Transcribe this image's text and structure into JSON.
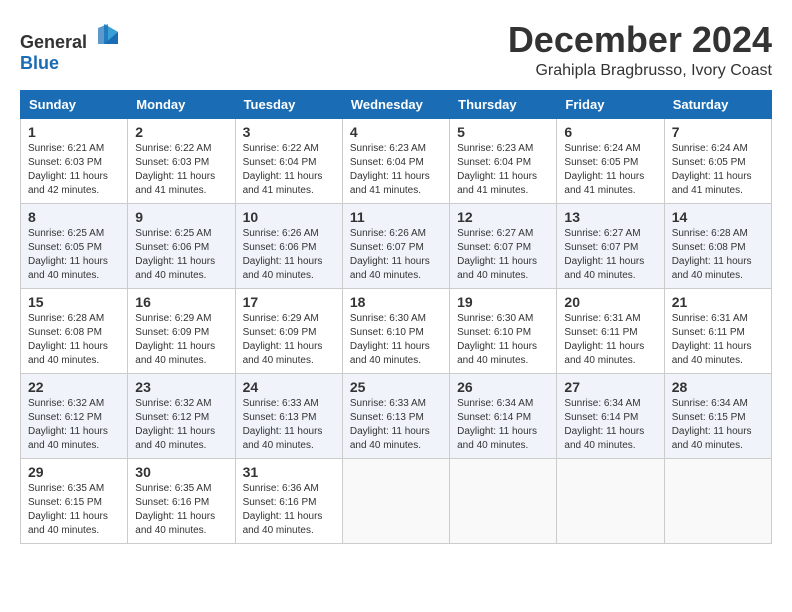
{
  "header": {
    "logo_general": "General",
    "logo_blue": "Blue",
    "month_title": "December 2024",
    "location": "Grahipla Bragbrusso, Ivory Coast"
  },
  "weekdays": [
    "Sunday",
    "Monday",
    "Tuesday",
    "Wednesday",
    "Thursday",
    "Friday",
    "Saturday"
  ],
  "weeks": [
    [
      {
        "day": "1",
        "sunrise": "6:21 AM",
        "sunset": "6:03 PM",
        "daylight": "11 hours and 42 minutes."
      },
      {
        "day": "2",
        "sunrise": "6:22 AM",
        "sunset": "6:03 PM",
        "daylight": "11 hours and 41 minutes."
      },
      {
        "day": "3",
        "sunrise": "6:22 AM",
        "sunset": "6:04 PM",
        "daylight": "11 hours and 41 minutes."
      },
      {
        "day": "4",
        "sunrise": "6:23 AM",
        "sunset": "6:04 PM",
        "daylight": "11 hours and 41 minutes."
      },
      {
        "day": "5",
        "sunrise": "6:23 AM",
        "sunset": "6:04 PM",
        "daylight": "11 hours and 41 minutes."
      },
      {
        "day": "6",
        "sunrise": "6:24 AM",
        "sunset": "6:05 PM",
        "daylight": "11 hours and 41 minutes."
      },
      {
        "day": "7",
        "sunrise": "6:24 AM",
        "sunset": "6:05 PM",
        "daylight": "11 hours and 41 minutes."
      }
    ],
    [
      {
        "day": "8",
        "sunrise": "6:25 AM",
        "sunset": "6:05 PM",
        "daylight": "11 hours and 40 minutes."
      },
      {
        "day": "9",
        "sunrise": "6:25 AM",
        "sunset": "6:06 PM",
        "daylight": "11 hours and 40 minutes."
      },
      {
        "day": "10",
        "sunrise": "6:26 AM",
        "sunset": "6:06 PM",
        "daylight": "11 hours and 40 minutes."
      },
      {
        "day": "11",
        "sunrise": "6:26 AM",
        "sunset": "6:07 PM",
        "daylight": "11 hours and 40 minutes."
      },
      {
        "day": "12",
        "sunrise": "6:27 AM",
        "sunset": "6:07 PM",
        "daylight": "11 hours and 40 minutes."
      },
      {
        "day": "13",
        "sunrise": "6:27 AM",
        "sunset": "6:07 PM",
        "daylight": "11 hours and 40 minutes."
      },
      {
        "day": "14",
        "sunrise": "6:28 AM",
        "sunset": "6:08 PM",
        "daylight": "11 hours and 40 minutes."
      }
    ],
    [
      {
        "day": "15",
        "sunrise": "6:28 AM",
        "sunset": "6:08 PM",
        "daylight": "11 hours and 40 minutes."
      },
      {
        "day": "16",
        "sunrise": "6:29 AM",
        "sunset": "6:09 PM",
        "daylight": "11 hours and 40 minutes."
      },
      {
        "day": "17",
        "sunrise": "6:29 AM",
        "sunset": "6:09 PM",
        "daylight": "11 hours and 40 minutes."
      },
      {
        "day": "18",
        "sunrise": "6:30 AM",
        "sunset": "6:10 PM",
        "daylight": "11 hours and 40 minutes."
      },
      {
        "day": "19",
        "sunrise": "6:30 AM",
        "sunset": "6:10 PM",
        "daylight": "11 hours and 40 minutes."
      },
      {
        "day": "20",
        "sunrise": "6:31 AM",
        "sunset": "6:11 PM",
        "daylight": "11 hours and 40 minutes."
      },
      {
        "day": "21",
        "sunrise": "6:31 AM",
        "sunset": "6:11 PM",
        "daylight": "11 hours and 40 minutes."
      }
    ],
    [
      {
        "day": "22",
        "sunrise": "6:32 AM",
        "sunset": "6:12 PM",
        "daylight": "11 hours and 40 minutes."
      },
      {
        "day": "23",
        "sunrise": "6:32 AM",
        "sunset": "6:12 PM",
        "daylight": "11 hours and 40 minutes."
      },
      {
        "day": "24",
        "sunrise": "6:33 AM",
        "sunset": "6:13 PM",
        "daylight": "11 hours and 40 minutes."
      },
      {
        "day": "25",
        "sunrise": "6:33 AM",
        "sunset": "6:13 PM",
        "daylight": "11 hours and 40 minutes."
      },
      {
        "day": "26",
        "sunrise": "6:34 AM",
        "sunset": "6:14 PM",
        "daylight": "11 hours and 40 minutes."
      },
      {
        "day": "27",
        "sunrise": "6:34 AM",
        "sunset": "6:14 PM",
        "daylight": "11 hours and 40 minutes."
      },
      {
        "day": "28",
        "sunrise": "6:34 AM",
        "sunset": "6:15 PM",
        "daylight": "11 hours and 40 minutes."
      }
    ],
    [
      {
        "day": "29",
        "sunrise": "6:35 AM",
        "sunset": "6:15 PM",
        "daylight": "11 hours and 40 minutes."
      },
      {
        "day": "30",
        "sunrise": "6:35 AM",
        "sunset": "6:16 PM",
        "daylight": "11 hours and 40 minutes."
      },
      {
        "day": "31",
        "sunrise": "6:36 AM",
        "sunset": "6:16 PM",
        "daylight": "11 hours and 40 minutes."
      },
      null,
      null,
      null,
      null
    ]
  ]
}
